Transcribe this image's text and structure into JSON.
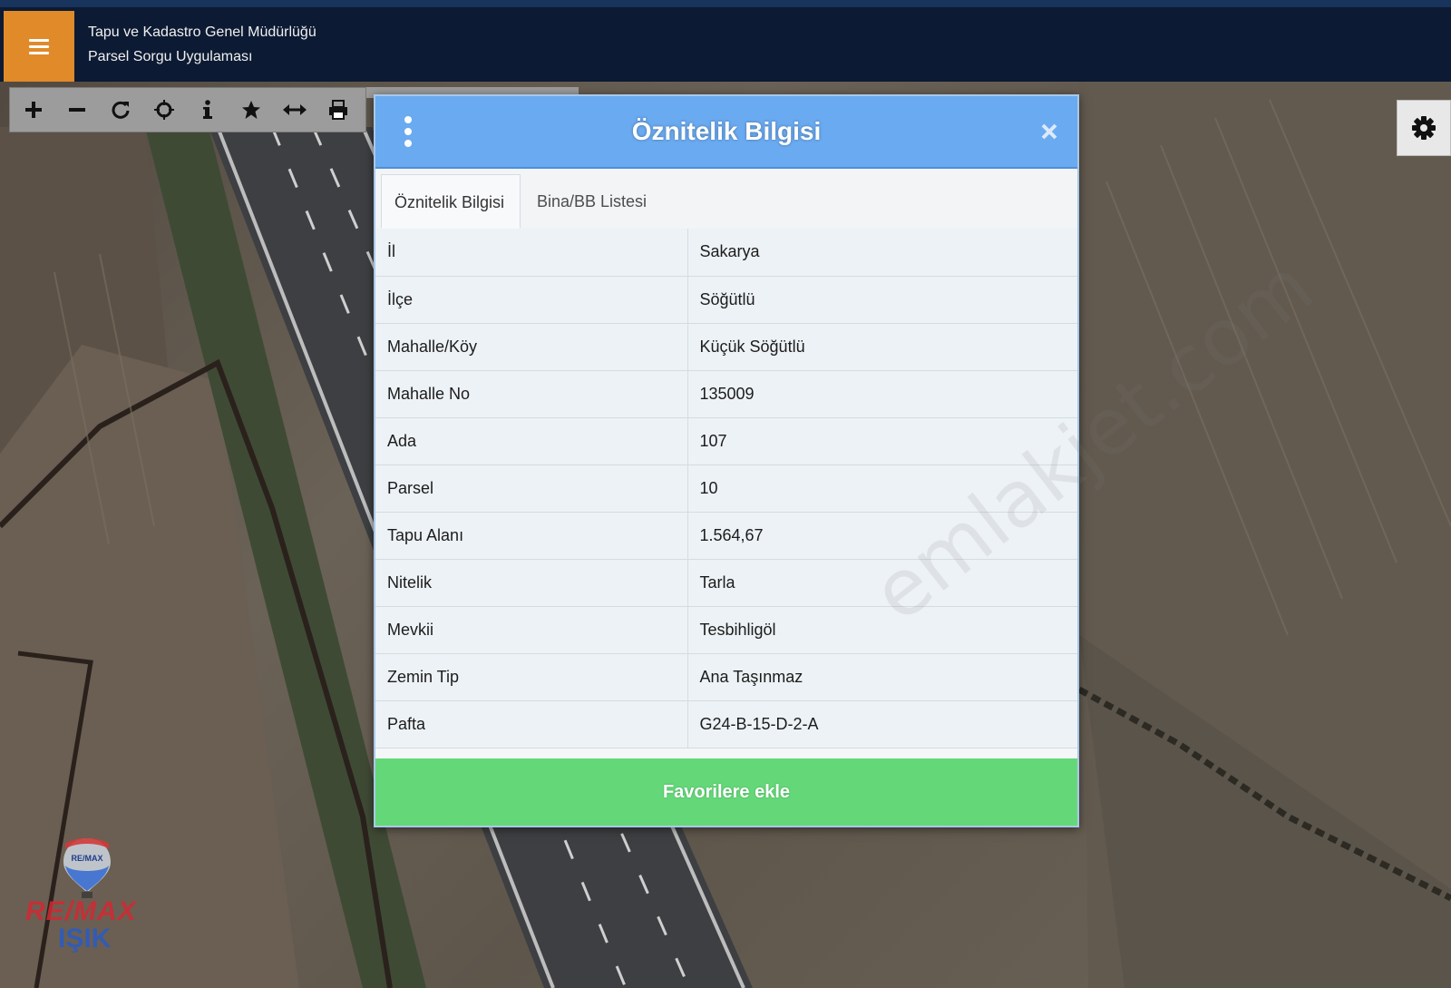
{
  "header": {
    "org_name": "Tapu ve Kadastro Genel Müdürlüğü",
    "app_name": "Parsel Sorgu Uygulaması",
    "menu_icon": "hamburger-icon"
  },
  "toolbar": {
    "tools": [
      "zoom-in-icon",
      "zoom-out-icon",
      "refresh-icon",
      "locate-icon",
      "info-icon",
      "favorite-star-icon",
      "measure-icon",
      "print-icon"
    ]
  },
  "settings": {
    "icon": "gear-icon"
  },
  "modal": {
    "title": "Öznitelik Bilgisi",
    "tabs": [
      {
        "label": "Öznitelik Bilgisi",
        "active": true
      },
      {
        "label": "Bina/BB Listesi",
        "active": false
      }
    ],
    "rows": [
      {
        "key": "İl",
        "value": "Sakarya"
      },
      {
        "key": "İlçe",
        "value": "Söğütlü"
      },
      {
        "key": "Mahalle/Köy",
        "value": "Küçük Söğütlü"
      },
      {
        "key": "Mahalle No",
        "value": "135009"
      },
      {
        "key": "Ada",
        "value": "107"
      },
      {
        "key": "Parsel",
        "value": "10"
      },
      {
        "key": "Tapu Alanı",
        "value": "1.564,67"
      },
      {
        "key": "Nitelik",
        "value": "Tarla"
      },
      {
        "key": "Mevkii",
        "value": "Tesbihligöl"
      },
      {
        "key": "Zemin Tip",
        "value": "Ana Taşınmaz"
      },
      {
        "key": "Pafta",
        "value": "G24-B-15-D-2-A"
      }
    ],
    "favorite_button": "Favorilere ekle"
  },
  "watermark": "emlakjet.com",
  "logo": {
    "balloon_text": "RE/MAX",
    "brand": "RE/MAX",
    "sub": "IŞIK"
  },
  "colors": {
    "header_bg": "#0c1a33",
    "menu_button": "#e08a2a",
    "modal_header": "#6aaaf0",
    "favorite_button": "#64d878"
  }
}
